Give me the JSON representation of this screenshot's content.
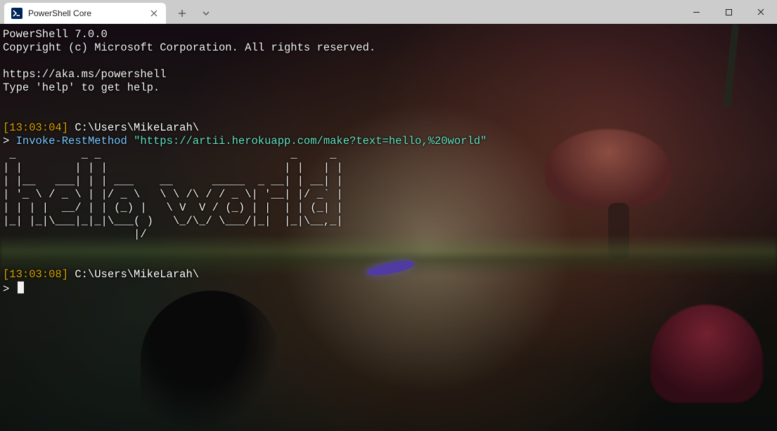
{
  "window": {
    "tab_title": "PowerShell Core"
  },
  "terminal": {
    "header": {
      "line1": "PowerShell 7.0.0",
      "line2": "Copyright (c) Microsoft Corporation. All rights reserved.",
      "link": "https://aka.ms/powershell",
      "help": "Type 'help' to get help."
    },
    "prompt1": {
      "timestamp": "[13:03:04]",
      "path": "C:\\Users\\MikeLarah\\",
      "symbol": ">",
      "command": "Invoke-RestMethod",
      "argument": "\"https://artii.herokuapp.com/make?text=hello,%20world\""
    },
    "ascii_art": " _          _ _                             _     _\n| |        | | |                           | |   | |\n| |__   ___| | | ___    __      _____  _ __| | __| |\n| '_ \\ / _ \\ | |/ _ \\   \\ \\ /\\ / / _ \\| '__| |/ _` |\n| | | |  __/ | | (_) |   \\ V  V / (_) | |  | | (_| |\n|_| |_|\\___|_|_|\\___( )   \\_/\\_/ \\___/|_|  |_|\\__,_|\n                    |/",
    "prompt2": {
      "timestamp": "[13:03:08]",
      "path": "C:\\Users\\MikeLarah\\",
      "symbol": ">"
    }
  }
}
